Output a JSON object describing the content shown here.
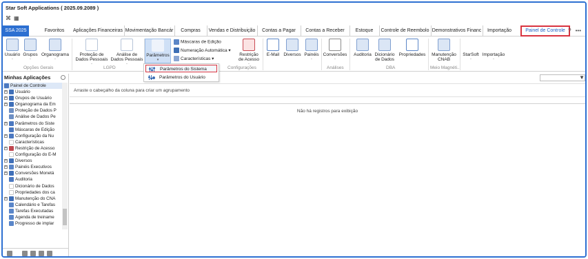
{
  "window": {
    "title": "Star Soft Applications ( 2025.09.2089 )"
  },
  "tabs": {
    "app_tab": "SSA 2025",
    "items": [
      "Favoritos",
      "Aplicações Financeiras",
      "Movimentação Bancár",
      "Compras",
      "Vendas e Distribuição",
      "Contas a Pagar",
      "Contas a Receber",
      "Estoque",
      "Controle de Reembolo",
      "Demonstrativos Financ",
      "Importação",
      "Painel de Controle"
    ],
    "active": "Painel de Controle"
  },
  "ribbon": {
    "buttons": {
      "usuario": "Usuário",
      "grupos": "Grupos",
      "organograma": "Organograma",
      "protecao": "Proteção de Dados Pessoais",
      "analise": "Análise de Dados Pessoais",
      "parametros": "Parâmetros",
      "restricao": "Restrição de Acesso",
      "email": "E-Mail",
      "diversos": "Diversos",
      "paineis": "Painéis",
      "conversoes": "Conversões",
      "auditoria": "Auditoria",
      "dicionario": "Dicionário de Dados",
      "propriedades": "Propriedades",
      "manutencao": "Manutenção CNAB",
      "starsoft": "StarSoft",
      "importacao": "Importação"
    },
    "small": {
      "mascaras": "Máscaras de Edição",
      "numeracao": "Numeração Automática",
      "caracteristicas": "Características"
    },
    "groups": {
      "opcoes": "Opções Gerais",
      "lgpd": "LGPD",
      "configuracoes": "Configurações",
      "analises": "Análises",
      "dba": "DBA",
      "meio": "Meio Magnéti..."
    }
  },
  "dropdown": {
    "items": [
      "Parâmetros do Sistema",
      "Parâmetros do Usuário"
    ]
  },
  "left_panel": {
    "title": "Minhas Aplicações",
    "root": "Painel de Controle",
    "nodes": [
      {
        "label": "Usuário",
        "expand": true,
        "color": "#3f6fb8"
      },
      {
        "label": "Grupos de Usuário",
        "expand": true,
        "color": "#3f6fb8"
      },
      {
        "label": "Organograma da Em",
        "expand": true,
        "color": "#3f6fb8"
      },
      {
        "label": "Proteção de Dados P",
        "expand": false,
        "color": "#6d8fc4"
      },
      {
        "label": "Análise de Dados Pe",
        "expand": false,
        "color": "#6d8fc4"
      },
      {
        "label": "Parâmetros do Siste",
        "expand": true,
        "color": "#4b78c0"
      },
      {
        "label": "Máscaras de Edição",
        "expand": false,
        "color": "#4b78c0"
      },
      {
        "label": "Configuração da Nu",
        "expand": true,
        "color": "#4b78c0"
      },
      {
        "label": "Características",
        "expand": false,
        "color": "#ffffff"
      },
      {
        "label": "Restrição de Acesso",
        "expand": true,
        "color": "#c0474f"
      },
      {
        "label": "Configuração do E-M",
        "expand": false,
        "color": "#ffffff"
      },
      {
        "label": "Diversos",
        "expand": true,
        "color": "#3f6fb8"
      },
      {
        "label": "Painéis Executivos",
        "expand": true,
        "color": "#5a86c9"
      },
      {
        "label": "Conversões Monetá",
        "expand": true,
        "color": "#3f6fb8"
      },
      {
        "label": "Auditoria",
        "expand": false,
        "color": "#4b78c0"
      },
      {
        "label": "Dicionário de Dados",
        "expand": false,
        "color": "#ffffff"
      },
      {
        "label": "Propriedades dos ca",
        "expand": false,
        "color": "#ffffff"
      },
      {
        "label": "Manutenção do CNA",
        "expand": true,
        "color": "#3f6fb8"
      },
      {
        "label": "Calendário e Tarefas",
        "expand": false,
        "color": "#5a86c9"
      },
      {
        "label": "Tarefas Executadas",
        "expand": false,
        "color": "#5a86c9"
      },
      {
        "label": "Agenda de treiname",
        "expand": false,
        "color": "#5a86c9"
      },
      {
        "label": "Progresso de implar",
        "expand": false,
        "color": "#5a86c9"
      }
    ]
  },
  "main": {
    "group_hint": "Arraste o cabeçalho da coluna para criar um agrupamento",
    "no_records": "Não há registros para exibição"
  },
  "colors": {
    "accent": "#2c6fd1",
    "highlight_border": "#d9333f"
  }
}
